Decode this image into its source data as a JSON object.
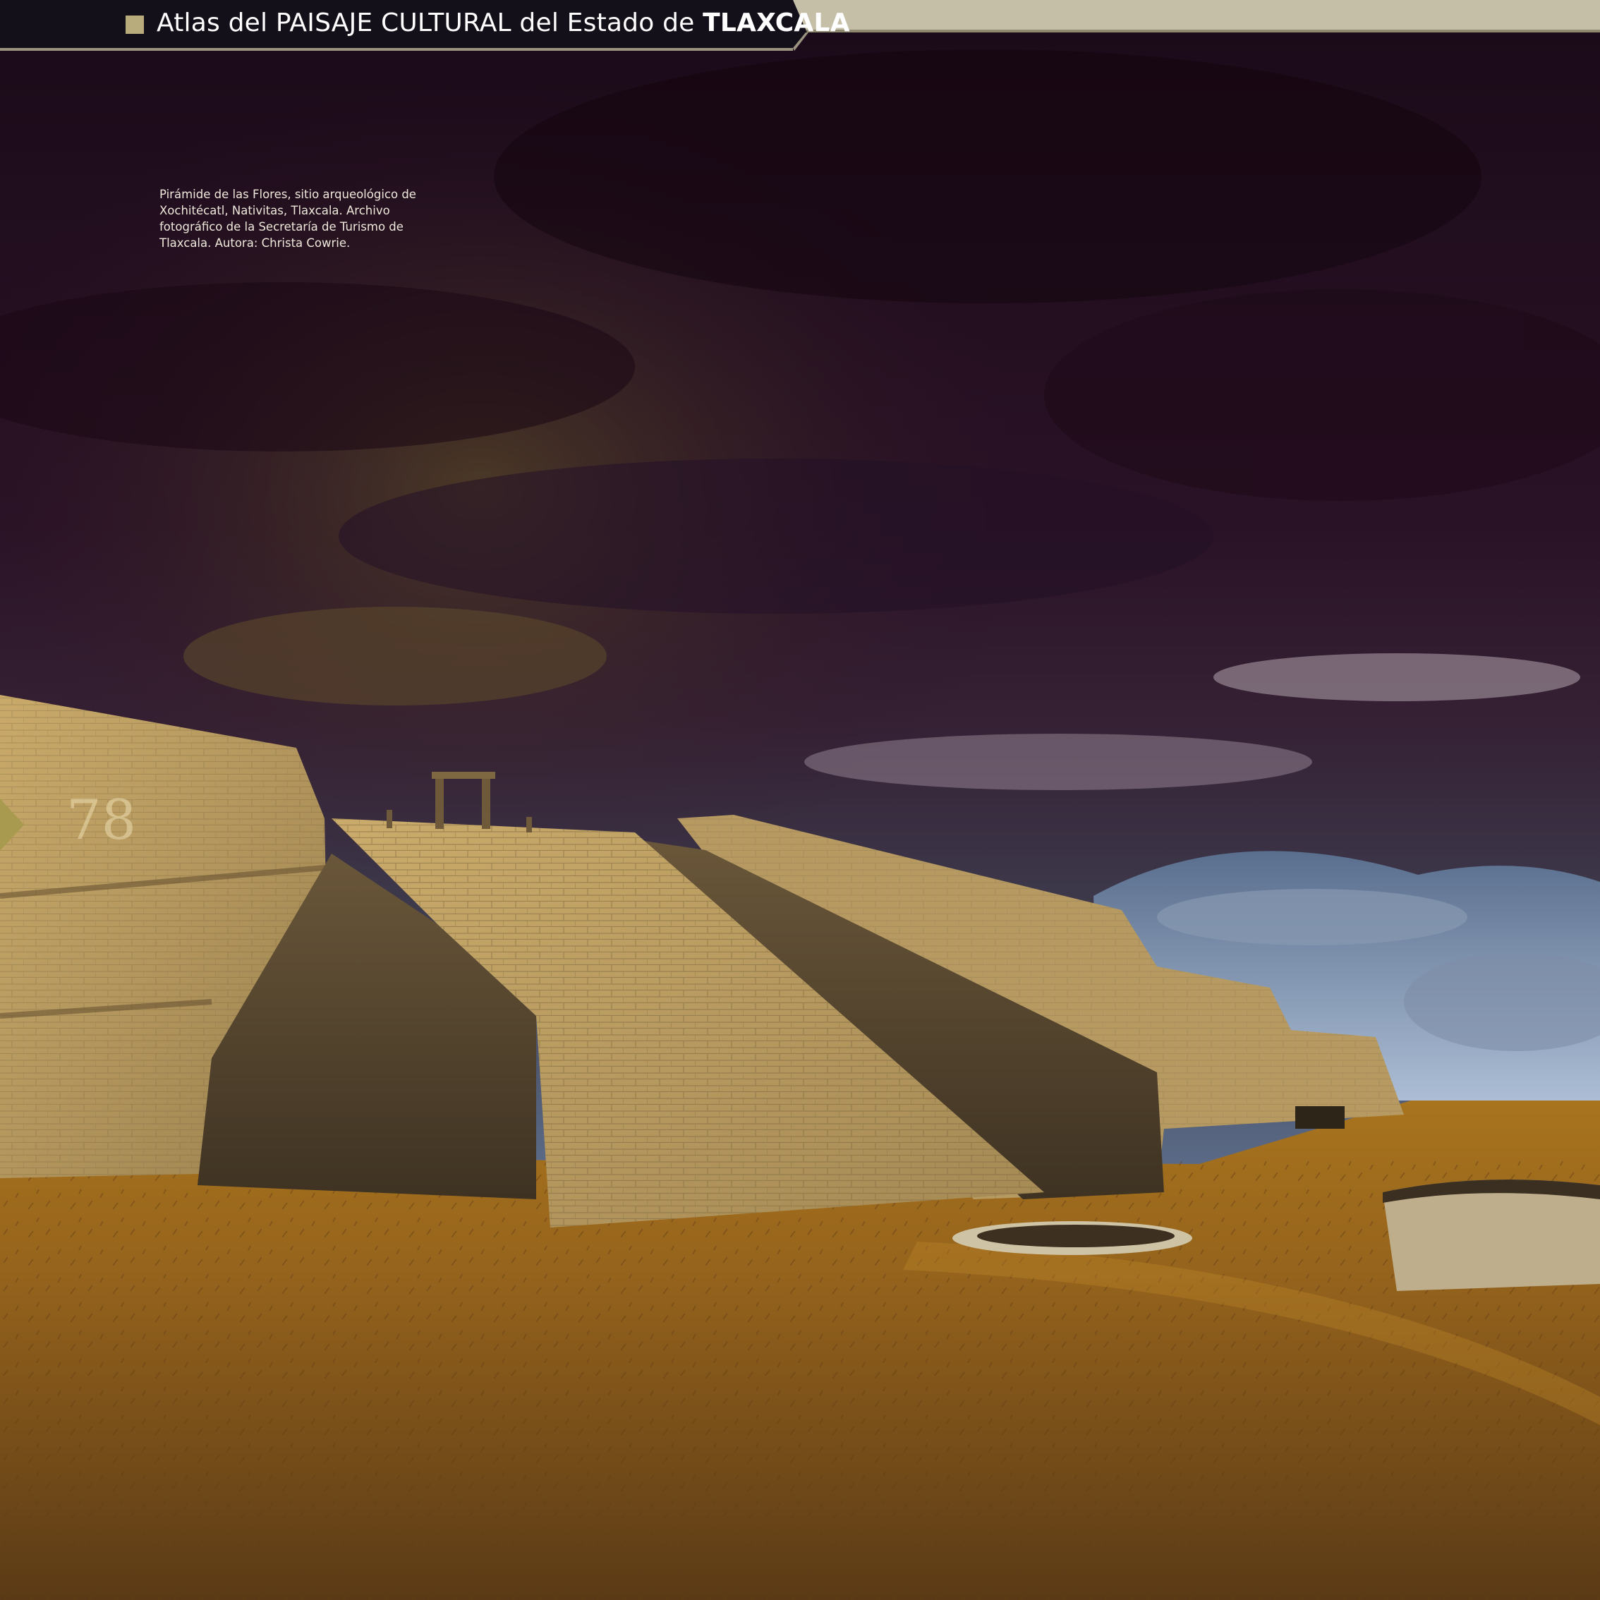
{
  "header": {
    "title_prefix": "Atlas del PAISAJE CULTURAL del Estado de",
    "title_emphasis": "TLAXCALA"
  },
  "caption": {
    "text": "Pirámide de las Flores, sitio arqueológico de Xochitécatl, Nativitas, Tlaxcala. Archivo fotográfico de la Secretaría de Turismo de Tlaxcala. Autora: Christa Cowrie."
  },
  "page_number": "78",
  "colors": {
    "header_bg": "#14101a",
    "accent_square": "#b9ac7c",
    "header_rule": "#9a937f",
    "sky_dark": "#1c0b1a",
    "stone": "#a88a54",
    "grass": "#8a5a1c"
  },
  "photo": {
    "subject": "pyramid-of-flowers-photo"
  }
}
